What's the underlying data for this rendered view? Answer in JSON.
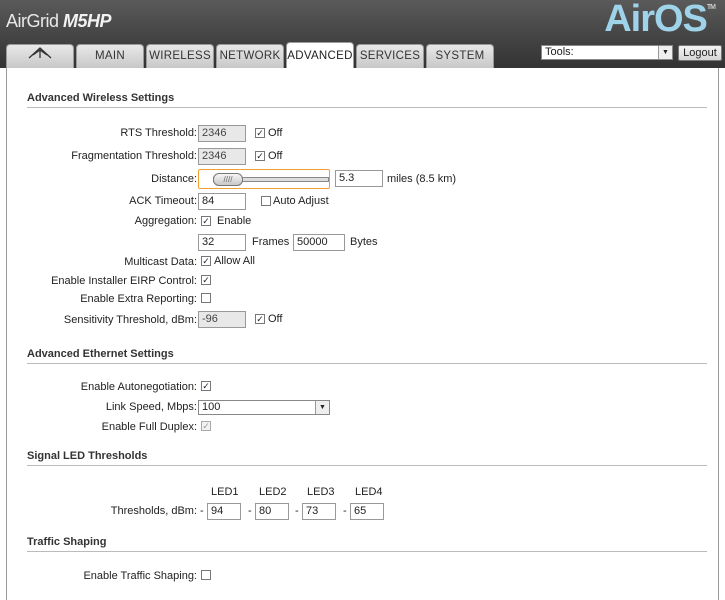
{
  "header": {
    "brand_prefix": "AirGrid",
    "brand_model": "M5HP",
    "os_logo": "AirOS",
    "tm": "TM",
    "tools_selected": "Tools:",
    "logout_label": "Logout"
  },
  "tabs": [
    {
      "label": "",
      "icon": "ubiquiti-logo-icon"
    },
    {
      "label": "MAIN"
    },
    {
      "label": "WIRELESS"
    },
    {
      "label": "NETWORK"
    },
    {
      "label": "ADVANCED",
      "active": true
    },
    {
      "label": "SERVICES"
    },
    {
      "label": "SYSTEM"
    }
  ],
  "advanced_wireless": {
    "title": "Advanced Wireless Settings",
    "rts_label": "RTS Threshold:",
    "rts_value": "2346",
    "rts_off_label": "Off",
    "frag_label": "Fragmentation Threshold:",
    "frag_value": "2346",
    "frag_off_label": "Off",
    "distance_label": "Distance:",
    "distance_value": "5.3",
    "distance_unit": "miles (8.5 km)",
    "ack_label": "ACK Timeout:",
    "ack_value": "84",
    "auto_adjust_label": "Auto Adjust",
    "aggregation_label": "Aggregation:",
    "aggregation_enable_label": "Enable",
    "frames_value": "32",
    "frames_label": "Frames",
    "bytes_value": "50000",
    "bytes_label": "Bytes",
    "multicast_label": "Multicast Data:",
    "multicast_allow_label": "Allow All",
    "eirp_label": "Enable Installer EIRP Control:",
    "extra_reporting_label": "Enable Extra Reporting:",
    "sensitivity_label": "Sensitivity Threshold, dBm:",
    "sensitivity_value": "-96",
    "sensitivity_off_label": "Off"
  },
  "advanced_ethernet": {
    "title": "Advanced Ethernet Settings",
    "autoneg_label": "Enable Autonegotiation:",
    "link_speed_label": "Link Speed, Mbps:",
    "link_speed_value": "100",
    "full_duplex_label": "Enable Full Duplex:"
  },
  "signal_led": {
    "title": "Signal LED Thresholds",
    "thresholds_label": "Thresholds, dBm:",
    "leds": [
      {
        "name": "LED1",
        "value": "94"
      },
      {
        "name": "LED2",
        "value": "80"
      },
      {
        "name": "LED3",
        "value": "73"
      },
      {
        "name": "LED4",
        "value": "65"
      }
    ],
    "dash": "-"
  },
  "traffic_shaping": {
    "title": "Traffic Shaping",
    "enable_label": "Enable Traffic Shaping:"
  },
  "checkmark": "✓"
}
